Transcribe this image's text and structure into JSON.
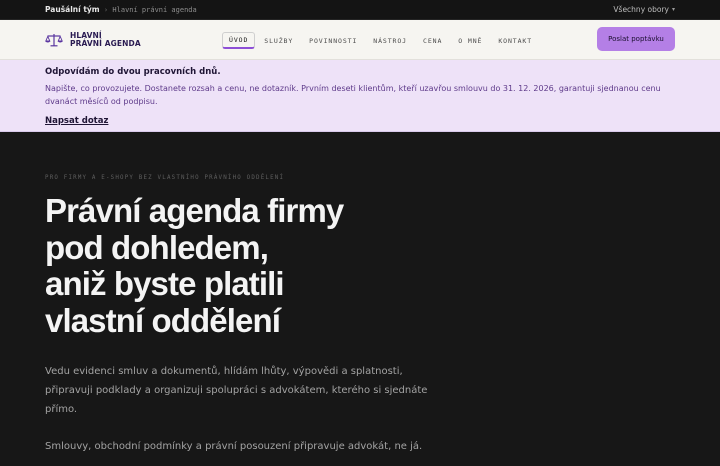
{
  "topbar": {
    "breadcrumb_home": "Paušální tým",
    "breadcrumb_separator": "›",
    "breadcrumb_current": "Hlavní právní agenda",
    "fields_dropdown": "Všechny obory",
    "fields_caret": "▾"
  },
  "header": {
    "logo_line1": "HLAVNÍ",
    "logo_line2": "PRÁVNÍ AGENDA",
    "logo_icon": "scales-icon",
    "nav": [
      "ÚVOD",
      "SLUŽBY",
      "POVINNOSTI",
      "NÁSTROJ",
      "CENA",
      "O MNĚ",
      "KONTAKT"
    ],
    "active_nav": "ÚVOD",
    "cta_label": "Poslat poptávku"
  },
  "notice": {
    "title": "Odpovídám do dvou pracovních dnů.",
    "text": "Napište, co provozujete. Dostanete rozsah a cenu, ne dotazník. Prvním deseti klientům, kteří uzavřou smlouvu do 31. 12. 2026, garantuji sjednanou cenu dvanáct měsíců od podpisu.",
    "link": "Napsat dotaz"
  },
  "hero": {
    "eyebrow": "PRO FIRMY A E-SHOPY BEZ VLASTNÍHO PRÁVNÍHO ODDĚLENÍ",
    "title_lines": [
      "Právní agenda firmy",
      "pod dohledem,",
      "aniž byste platili",
      "vlastní oddělení"
    ],
    "lead": "Vedu evidenci smluv a dokumentů, hlídám lhůty, výpovědi a splatnosti, připravuji podklady a organizuji spolupráci s advokátem, kterého si sjednáte přímo.",
    "lead2": "Smlouvy, obchodní podmínky a právní posouzení připravuje advokát, ne já."
  },
  "colors": {
    "accent": "#b47fe6",
    "brand_dark": "#2a1b52",
    "hero_bg": "#171717",
    "notice_bg": "#eee2f8"
  }
}
